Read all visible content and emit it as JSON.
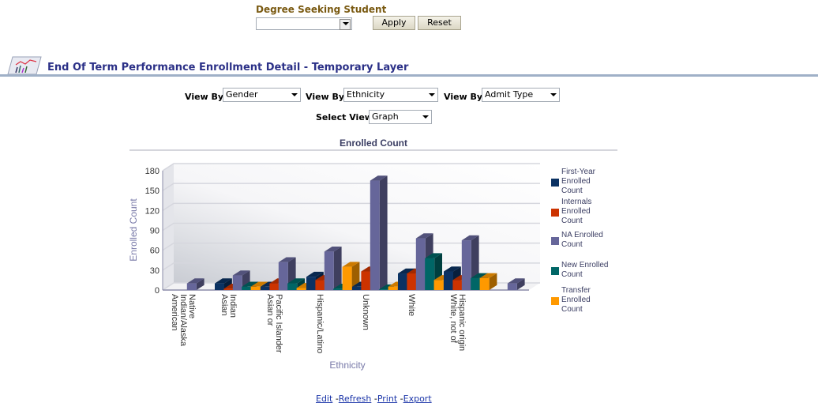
{
  "prompt": {
    "label": "Degree Seeking Student",
    "value": "",
    "apply_label": "Apply",
    "reset_label": "Reset"
  },
  "section": {
    "title": "End Of Term Performance Enrollment Detail - Temporary Layer",
    "icon": "chart-report-icon"
  },
  "controls": {
    "viewby_label": "View By",
    "viewby1": "Gender",
    "viewby2": "Ethnicity",
    "viewby3": "Admit Type",
    "select_view_label": "Select View",
    "select_view": "Graph"
  },
  "footer": {
    "edit": "Edit",
    "refresh": "Refresh",
    "print": "Print",
    "export": "Export",
    "sep": "-"
  },
  "colors": {
    "First-Year Enrolled Count": "#0b3263",
    "Internals Enrolled Count": "#cc3300",
    "NA Enrolled Count": "#66669a",
    "New Enrolled Count": "#006666",
    "Transfer Enrolled Count": "#ff9900"
  },
  "chart_data": {
    "type": "bar",
    "title": "Enrolled Count",
    "xlabel": "Ethnicity",
    "ylabel": "Enrolled Count",
    "ylim": [
      0,
      180
    ],
    "yticks": [
      0,
      30,
      60,
      90,
      120,
      150,
      180
    ],
    "grid": true,
    "legend": "right",
    "categories": [
      "American Indian/Alaska Native",
      "Asian Indian",
      "Asian or Pacific Islander",
      "Hispanic/Latino",
      "Unknown",
      "White",
      "White, not of Hispanic origin",
      ""
    ],
    "category_lines": [
      [
        "American",
        "Indian/Alaska",
        "Native"
      ],
      [
        "Asian",
        "Indian"
      ],
      [
        "Asian or",
        "Pacific Islander"
      ],
      [
        "Hispanic/Latino"
      ],
      [
        "Unknown"
      ],
      [
        "White"
      ],
      [
        "White, not of",
        "Hispanic origin"
      ],
      []
    ],
    "series": [
      {
        "name": "First-Year Enrolled Count",
        "legend_lines": [
          "First-Year",
          "Enrolled",
          "Count"
        ],
        "values": [
          0,
          10,
          5,
          20,
          5,
          25,
          28,
          0
        ]
      },
      {
        "name": "Internals Enrolled Count",
        "legend_lines": [
          "Internals",
          "Enrolled",
          "Count"
        ],
        "values": [
          0,
          2,
          10,
          15,
          28,
          25,
          15,
          0
        ]
      },
      {
        "name": "NA Enrolled Count",
        "legend_lines": [
          "NA Enrolled",
          "Count"
        ],
        "values": [
          10,
          22,
          42,
          58,
          165,
          78,
          75,
          10
        ]
      },
      {
        "name": "New Enrolled Count",
        "legend_lines": [
          "New Enrolled",
          "Count"
        ],
        "values": [
          0,
          5,
          10,
          2,
          1,
          48,
          18,
          0
        ]
      },
      {
        "name": "Transfer Enrolled Count",
        "legend_lines": [
          "Transfer",
          "Enrolled",
          "Count"
        ],
        "values": [
          0,
          5,
          3,
          35,
          5,
          15,
          18,
          0
        ]
      }
    ]
  }
}
